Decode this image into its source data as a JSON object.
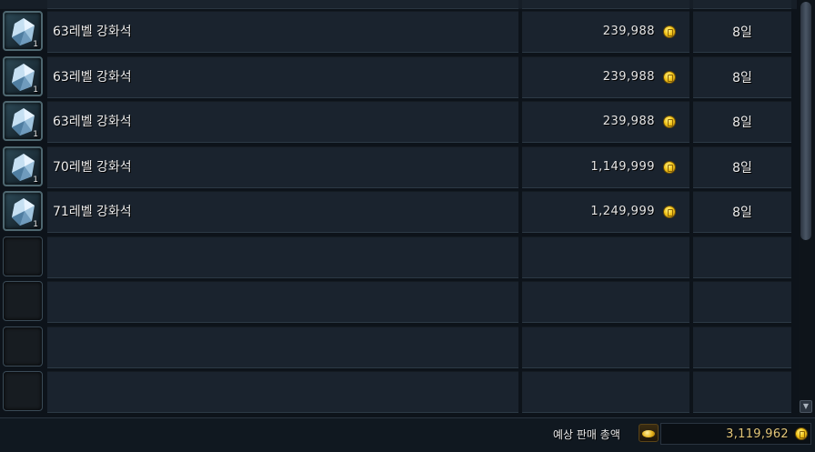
{
  "rows": [
    {
      "name": "63레벨 강화석",
      "qty": "1",
      "price": "239,988",
      "time": "8일"
    },
    {
      "name": "63레벨 강화석",
      "qty": "1",
      "price": "239,988",
      "time": "8일"
    },
    {
      "name": "63레벨 강화석",
      "qty": "1",
      "price": "239,988",
      "time": "8일"
    },
    {
      "name": "70레벨 강화석",
      "qty": "1",
      "price": "1,149,999",
      "time": "8일"
    },
    {
      "name": "71레벨 강화석",
      "qty": "1",
      "price": "1,249,999",
      "time": "8일"
    }
  ],
  "empty_rows": 4,
  "footer": {
    "label": "예상 판매 총액",
    "total": "3,119,962"
  },
  "icons": {
    "item": "enhancement-stone-icon",
    "currency": "gold-coin-icon",
    "total": "gold-pouch-icon"
  },
  "colors": {
    "row_bg": "#1a232e",
    "coin": "#f2c418",
    "total_text": "#e3c77a"
  }
}
